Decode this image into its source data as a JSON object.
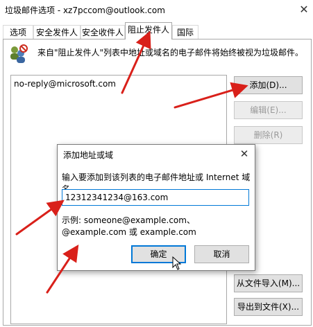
{
  "window": {
    "title": "垃圾邮件选项 - xz7pccom@outlook.com",
    "close_glyph": "✕"
  },
  "tabs": [
    {
      "label": "选项",
      "active": false
    },
    {
      "label": "安全发件人",
      "active": false
    },
    {
      "label": "安全收件人",
      "active": false
    },
    {
      "label": "阻止发件人",
      "active": true
    },
    {
      "label": "国际",
      "active": false
    }
  ],
  "panel": {
    "info_text": "来自\"阻止发件人\"列表中地址或域名的电子邮件将始终被视为垃圾邮件。",
    "blocked_list": [
      "no-reply@microsoft.com"
    ]
  },
  "buttons": {
    "add": "添加(D)...",
    "edit": "编辑(E)...",
    "delete": "删除(R)",
    "import": "从文件导入(M)...",
    "export": "导出到文件(X)..."
  },
  "dialog": {
    "title": "添加地址或域",
    "close_glyph": "✕",
    "prompt": "输入要添加到该列表的电子邮件地址或 Internet 域名。",
    "input_value": "12312341234@163.com",
    "example": "示例: someone@example.com、@example.com 或 example.com",
    "ok_label": "确定",
    "cancel_label": "取消"
  },
  "icons": {
    "title_close": "close-icon",
    "info": "blocked-senders-icon",
    "dialog_close": "close-icon",
    "cursor": "mouse-pointer-icon",
    "annotation": "red-arrow-icon"
  },
  "colors": {
    "arrow": "#d9201a",
    "focus": "#0078d7",
    "button_bg": "#e1e1e1",
    "disabled_text": "#9a9a9a"
  }
}
